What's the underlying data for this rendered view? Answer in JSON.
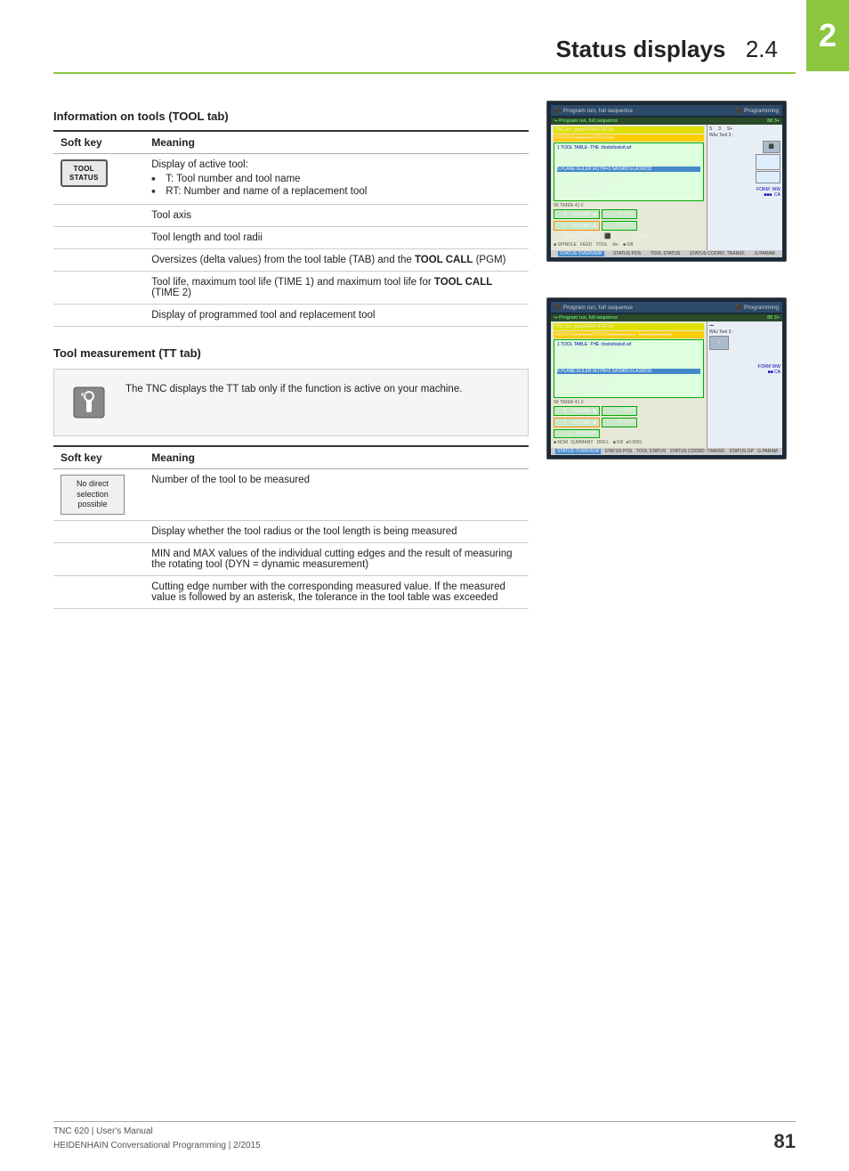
{
  "page": {
    "chapter_number": "2",
    "title": "Status displays",
    "section": "2.4"
  },
  "tool_tab_section": {
    "heading": "Information on tools (TOOL tab)",
    "col1": "Soft key",
    "col2": "Meaning",
    "rows": [
      {
        "key_label_line1": "TOOL",
        "key_label_line2": "STATUS",
        "meaning_main": "Display of active tool:",
        "bullets": [
          "T: Tool number and tool name",
          "RT: Number and name of a replacement tool"
        ]
      },
      {
        "key_label_line1": "",
        "key_label_line2": "",
        "meaning_main": "Tool axis",
        "bullets": []
      },
      {
        "key_label_line1": "",
        "key_label_line2": "",
        "meaning_main": "Tool length and tool radii",
        "bullets": []
      },
      {
        "key_label_line1": "",
        "key_label_line2": "",
        "meaning_main": "Oversizes (delta values) from the tool table (TAB) and the",
        "meaning_bold": "TOOL CALL",
        "meaning_suffix": " (PGM)",
        "bullets": []
      },
      {
        "key_label_line1": "",
        "key_label_line2": "",
        "meaning_main": "Tool life, maximum tool life (TIME 1) and maximum tool life for",
        "meaning_bold": "TOOL CALL",
        "meaning_suffix": " (TIME 2)",
        "bullets": []
      },
      {
        "key_label_line1": "",
        "key_label_line2": "",
        "meaning_main": "Display of programmed tool and replacement tool",
        "bullets": []
      }
    ]
  },
  "tt_tab_section": {
    "heading": "Tool measurement (TT tab)",
    "note": "The TNC displays the TT tab only if the function is active on your machine.",
    "col1": "Soft key",
    "col2": "Meaning",
    "rows": [
      {
        "key_label": "No direct\nselection\npossible",
        "meaning_main": "Number of the tool to be measured"
      },
      {
        "key_label": "",
        "meaning_main": "Display whether the tool radius or the tool length is being measured"
      },
      {
        "key_label": "",
        "meaning_main": "MIN and MAX values of the individual cutting edges and the result of measuring the rotating tool (DYN = dynamic measurement)"
      },
      {
        "key_label": "",
        "meaning_main": "Cutting edge number with the corresponding measured value. If the measured value is followed by an asterisk, the tolerance in the tool table was exceeded"
      }
    ]
  },
  "footer": {
    "line1": "TNC 620 | User's Manual",
    "line2": "HEIDENHAIN Conversational Programming | 2/2015",
    "page_number": "81"
  }
}
